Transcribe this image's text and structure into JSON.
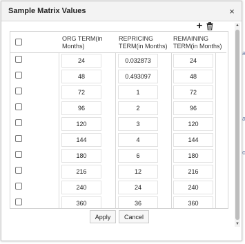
{
  "dialog": {
    "title": "Sample Matrix Values",
    "close_glyph": "×"
  },
  "toolbar": {
    "add_glyph": "+",
    "delete_icon": "trash-icon"
  },
  "table": {
    "headers": [
      "ORG TERM(in Months)",
      "REPRICING TERM(in Months)",
      "REMAINING TERM(in Months)"
    ],
    "rows": [
      [
        "24",
        "0.032873",
        "24"
      ],
      [
        "48",
        "0.493097",
        "48"
      ],
      [
        "72",
        "1",
        "72"
      ],
      [
        "96",
        "2",
        "96"
      ],
      [
        "120",
        "3",
        "120"
      ],
      [
        "144",
        "4",
        "144"
      ],
      [
        "180",
        "6",
        "180"
      ],
      [
        "216",
        "12",
        "216"
      ],
      [
        "240",
        "24",
        "240"
      ],
      [
        "360",
        "36",
        "360"
      ]
    ]
  },
  "buttons": {
    "apply": "Apply",
    "cancel": "Cancel"
  },
  "background_fragments": [
    "a",
    "a",
    "o"
  ]
}
